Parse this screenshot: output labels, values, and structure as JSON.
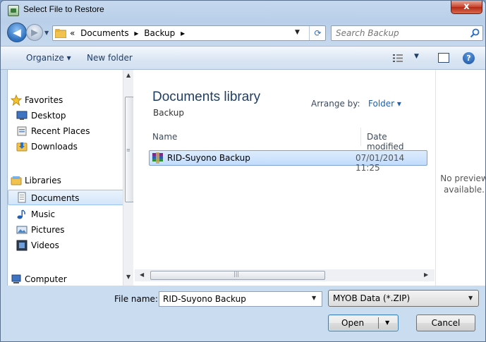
{
  "window": {
    "title": "Select File to Restore",
    "close_glyph": "x"
  },
  "address_bar": {
    "overflow_glyph": "«",
    "breadcrumbs": [
      "Documents",
      "Backup"
    ],
    "separator": "▸"
  },
  "search": {
    "placeholder": "Search Backup"
  },
  "toolbar": {
    "organize": "Organize ▾",
    "new_folder": "New folder"
  },
  "nav": {
    "favorites_header": "Favorites",
    "favorites": [
      "Desktop",
      "Recent Places",
      "Downloads"
    ],
    "libraries_header": "Libraries",
    "libraries": [
      "Documents",
      "Music",
      "Pictures",
      "Videos"
    ],
    "computer": "Computer",
    "selected": "Documents"
  },
  "library": {
    "title": "Documents library",
    "subtitle": "Backup",
    "arrange_label": "Arrange by:",
    "arrange_value": "Folder ▾"
  },
  "columns": {
    "name": "Name",
    "date": "Date modified"
  },
  "files": [
    {
      "name": "RID-Suyono Backup",
      "date": "07/01/2014 11:25",
      "selected": true
    }
  ],
  "preview": {
    "line1": "No preview",
    "line2": "available."
  },
  "bottom": {
    "file_name_label": "File name:",
    "file_name_value": "RID-Suyono Backup",
    "file_type": "MYOB Data (*.ZIP)",
    "open_label": "Open",
    "cancel_label": "Cancel"
  },
  "icons": {
    "back": "back-arrow-icon",
    "forward": "forward-arrow-icon",
    "search": "search-icon",
    "help": "help-icon",
    "refresh": "refresh-icon",
    "file": "winrar-archive-icon"
  }
}
